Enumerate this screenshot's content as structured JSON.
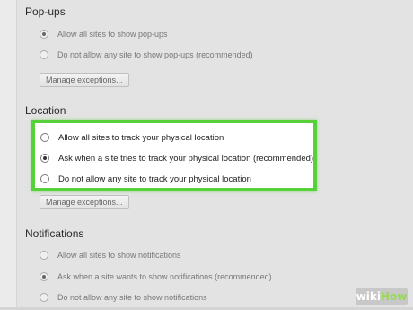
{
  "popups": {
    "title": "Pop-ups",
    "options": [
      {
        "label": "Allow all sites to show pop-ups",
        "checked": true
      },
      {
        "label": "Do not allow any site to show pop-ups (recommended)",
        "checked": false
      }
    ],
    "manage_button": "Manage exceptions..."
  },
  "location": {
    "title": "Location",
    "options": [
      {
        "label": "Allow all sites to track your physical location",
        "checked": false
      },
      {
        "label": "Ask when a site tries to track your physical location (recommended)",
        "checked": true
      },
      {
        "label": "Do not allow any site to track your physical location",
        "checked": false
      }
    ],
    "manage_button": "Manage exceptions..."
  },
  "notifications": {
    "title": "Notifications",
    "options": [
      {
        "label": "Allow all sites to show notifications",
        "checked": false
      },
      {
        "label": "Ask when a site wants to show notifications (recommended)",
        "checked": true
      },
      {
        "label": "Do not allow any site to show notifications",
        "checked": false
      }
    ]
  },
  "watermark": {
    "part1": "wiki",
    "part2": "How"
  },
  "colors": {
    "highlight": "#57d13a",
    "background": "#e3e3e3"
  }
}
